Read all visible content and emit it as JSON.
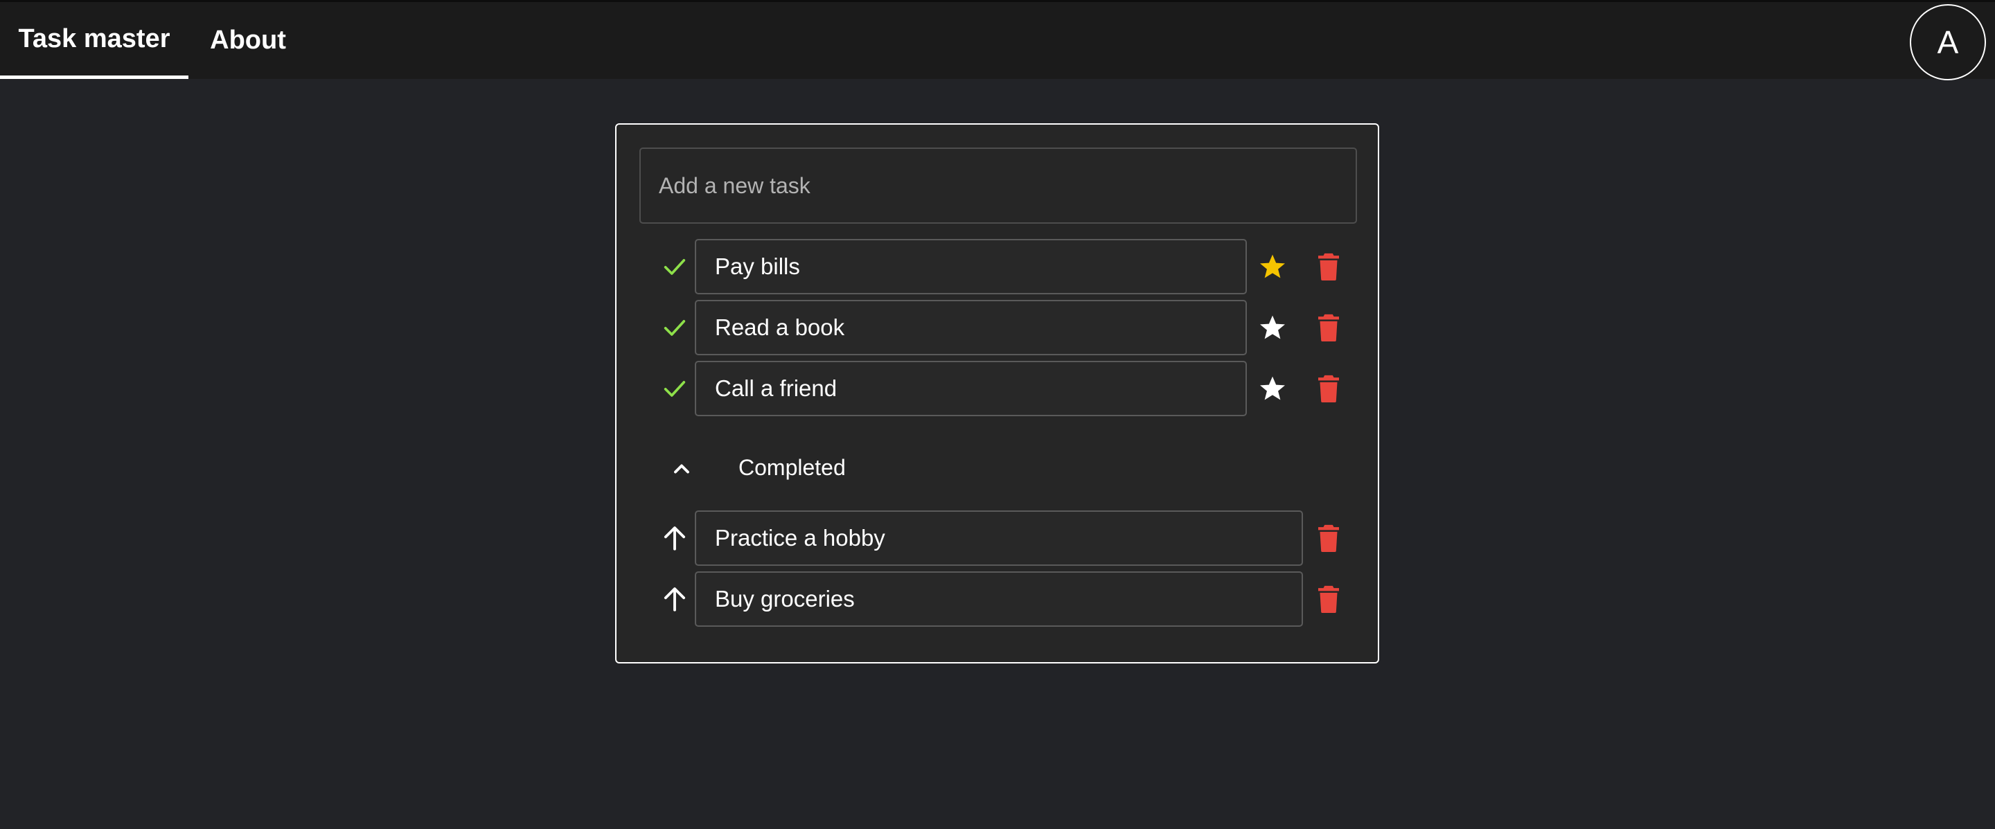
{
  "nav": {
    "tabs": [
      {
        "label": "Task master",
        "active": true
      },
      {
        "label": "About",
        "active": false
      }
    ],
    "avatar_letter": "A"
  },
  "new_task": {
    "placeholder": "Add a new task",
    "value": ""
  },
  "active_tasks": [
    {
      "title": "Pay bills",
      "starred": true
    },
    {
      "title": "Read a book",
      "starred": false
    },
    {
      "title": "Call a friend",
      "starred": false
    }
  ],
  "completed": {
    "label": "Completed",
    "expanded": true,
    "items": [
      {
        "title": "Practice a hobby"
      },
      {
        "title": "Buy groceries"
      }
    ]
  },
  "colors": {
    "check": "#8ee04a",
    "star_on": "#f5c400",
    "star_off": "#ffffff",
    "trash": "#e8453c",
    "background": "#222327",
    "panel": "#262626"
  },
  "icons": {
    "check": "check-icon",
    "star": "star-icon",
    "trash": "trash-icon",
    "chevron": "chevron-up-icon",
    "restore": "arrow-up-icon"
  }
}
